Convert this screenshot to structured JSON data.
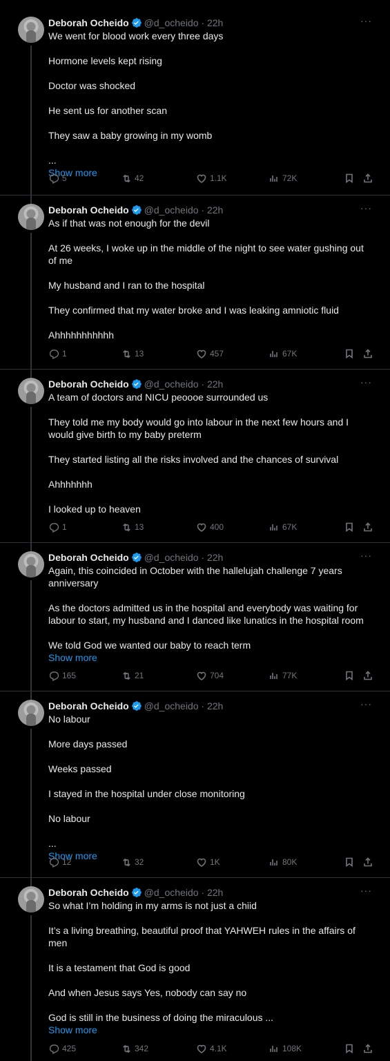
{
  "tweets": [
    {
      "name": "Deborah Ocheido",
      "handle": "@d_ocheido",
      "time": "22h",
      "paragraphs": [
        "We went for blood work every three days",
        "Hormone levels kept rising",
        "Doctor was shocked",
        "He sent us for another scan",
        "They saw  a baby growing in my womb",
        "..."
      ],
      "show_more": "Show more",
      "replies": "5",
      "reposts": "42",
      "likes": "1.1K",
      "views": "72K"
    },
    {
      "name": "Deborah Ocheido",
      "handle": "@d_ocheido",
      "time": "22h",
      "paragraphs": [
        "As if that was not enough for the devil",
        "At 26 weeks, I woke up in the middle of the night to see water gushing out of me",
        "My husband and I ran to the hospital",
        "They confirmed that my water broke and I was leaking amniotic fluid",
        "Ahhhhhhhhhhh"
      ],
      "show_more": "",
      "replies": "1",
      "reposts": "13",
      "likes": "457",
      "views": "67K"
    },
    {
      "name": "Deborah Ocheido",
      "handle": "@d_ocheido",
      "time": "22h",
      "paragraphs": [
        "A team of doctors and NICU peoooe surrounded us",
        "They told me my body would go into labour in the next few hours and I would give birth to my baby preterm",
        "They started listing all the risks involved and the chances of survival",
        "Ahhhhhhh",
        "I looked up to heaven"
      ],
      "show_more": "",
      "replies": "1",
      "reposts": "13",
      "likes": "400",
      "views": "67K"
    },
    {
      "name": "Deborah Ocheido",
      "handle": "@d_ocheido",
      "time": "22h",
      "paragraphs": [
        "Again, this coincided in October with the hallelujah challenge 7 years anniversary",
        "As the doctors admitted us in the hospital and everybody was waiting for labour to start, my husband and I danced like lunatics in the hospital room",
        "We told God we wanted our baby to reach term"
      ],
      "show_more": "Show more",
      "replies": "165",
      "reposts": "21",
      "likes": "704",
      "views": "77K"
    },
    {
      "name": "Deborah Ocheido",
      "handle": "@d_ocheido",
      "time": "22h",
      "paragraphs": [
        "No labour",
        "More days passed",
        "Weeks passed",
        "I stayed in the hospital under close monitoring",
        " No labour",
        "..."
      ],
      "show_more": "Show more",
      "replies": "12",
      "reposts": "32",
      "likes": "1K",
      "views": "80K"
    },
    {
      "name": "Deborah Ocheido",
      "handle": "@d_ocheido",
      "time": "22h",
      "paragraphs": [
        "So what I’m holding in my arms is not just a chiid",
        "It’s a living breathing, beautiful proof that YAHWEH rules in the affairs of men",
        "It is a testament that God is good",
        "And when Jesus says Yes, nobody can say no",
        "God is still in the business of doing the miraculous ..."
      ],
      "show_more": "Show more",
      "replies": "425",
      "reposts": "342",
      "likes": "4.1K",
      "views": "108K"
    }
  ],
  "colors": {
    "background": "#000000",
    "text": "#e7e9ea",
    "muted": "#71767b",
    "link": "#1d9bf0",
    "verified": "#1d9bf0"
  }
}
